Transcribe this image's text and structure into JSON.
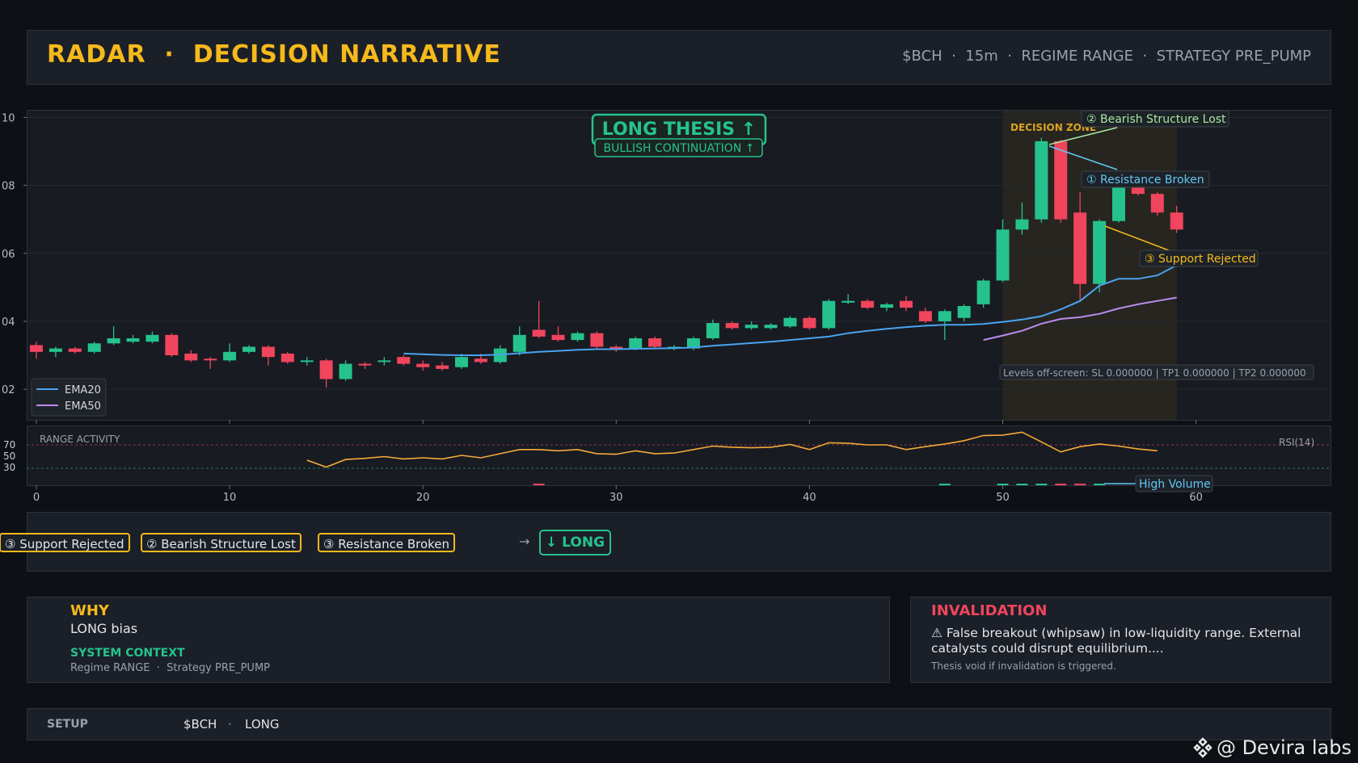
{
  "header": {
    "title": "RADAR  ·  DECISION NARRATIVE",
    "meta": "$BCH  ·  15m  ·  REGIME RANGE  ·  STRATEGY PRE_PUMP"
  },
  "thesis": {
    "title": "LONG THESIS  ↑",
    "subtitle": "BULLISH CONTINUATION ↑"
  },
  "decision_zone_label": "DECISION ZONE",
  "callouts": {
    "bearish": "② Bearish Structure Lost",
    "resistance": "① Resistance Broken",
    "support": "③ Support Rejected",
    "high_volume": "High Volume"
  },
  "levels_note": "Levels off-screen: SL 0.000000 | TP1 0.000000 | TP2 0.000000",
  "rsi_panel": {
    "label": "RANGE ACTIVITY",
    "indicator": "RSI(14)",
    "levels": [
      "70",
      "50",
      "30"
    ]
  },
  "chips": {
    "support": "③ Support Rejected",
    "bearish": "② Bearish Structure Lost",
    "resistance": "③ Resistance Broken",
    "arrow": "→",
    "long": "↓ LONG"
  },
  "why": {
    "heading": "WHY",
    "bias": "LONG bias",
    "context_heading": "SYSTEM CONTEXT",
    "context": "Regime RANGE  ·  Strategy PRE_PUMP"
  },
  "invalidation": {
    "heading": "INVALIDATION",
    "text": "⚠ False breakout (whipsaw) in low-liquidity range. External catalysts could disrupt equilibrium....",
    "note": "Thesis void if invalidation is triggered."
  },
  "setup": {
    "label": "SETUP",
    "symbol": "$BCH",
    "sep": "·",
    "direction": "LONG"
  },
  "watermark": "@ Devira labs",
  "colors": {
    "accent": "#f5b91c",
    "bull": "#26c28e",
    "bear": "#f0455d",
    "ema20": "#4aa3f0",
    "ema50": "#b98cf0",
    "rsi": "#f5a93a",
    "volume_label": "#63c6f5"
  },
  "chart_data": {
    "type": "candlestick",
    "x_ticks": [
      0,
      10,
      20,
      30,
      40,
      50,
      60
    ],
    "xlim": [
      -0.5,
      67
    ],
    "y_ticks": [
      {
        "v": 10,
        "label": "10"
      },
      {
        "v": 8,
        "label": "08"
      },
      {
        "v": 6,
        "label": "06"
      },
      {
        "v": 4,
        "label": "04"
      },
      {
        "v": 2,
        "label": "02"
      }
    ],
    "ylim": [
      1.1,
      10.2
    ],
    "candles": [
      [
        3.3,
        3.1,
        3.4,
        2.9
      ],
      [
        3.1,
        3.2,
        3.25,
        2.95
      ],
      [
        3.2,
        3.1,
        3.25,
        3.05
      ],
      [
        3.1,
        3.35,
        3.4,
        3.05
      ],
      [
        3.35,
        3.5,
        3.85,
        3.3
      ],
      [
        3.4,
        3.5,
        3.6,
        3.35
      ],
      [
        3.4,
        3.6,
        3.7,
        3.35
      ],
      [
        3.6,
        3.0,
        3.65,
        2.95
      ],
      [
        3.05,
        2.85,
        3.15,
        2.8
      ],
      [
        2.9,
        2.85,
        2.95,
        2.6
      ],
      [
        2.85,
        3.1,
        3.35,
        2.8
      ],
      [
        3.1,
        3.25,
        3.3,
        3.05
      ],
      [
        3.25,
        2.95,
        3.3,
        2.7
      ],
      [
        3.05,
        2.8,
        3.1,
        2.75
      ],
      [
        2.85,
        2.85,
        2.95,
        2.7
      ],
      [
        2.85,
        2.3,
        2.9,
        2.05
      ],
      [
        2.3,
        2.75,
        2.85,
        2.25
      ],
      [
        2.75,
        2.7,
        2.8,
        2.6
      ],
      [
        2.85,
        2.85,
        2.95,
        2.7
      ],
      [
        2.95,
        2.75,
        3.0,
        2.7
      ],
      [
        2.75,
        2.65,
        2.85,
        2.55
      ],
      [
        2.7,
        2.6,
        2.8,
        2.55
      ],
      [
        2.65,
        2.95,
        3.05,
        2.6
      ],
      [
        2.9,
        2.8,
        3.05,
        2.75
      ],
      [
        2.8,
        3.2,
        3.3,
        2.75
      ],
      [
        3.1,
        3.6,
        3.85,
        3.0
      ],
      [
        3.75,
        3.55,
        4.6,
        3.5
      ],
      [
        3.6,
        3.45,
        3.85,
        3.4
      ],
      [
        3.45,
        3.65,
        3.7,
        3.4
      ],
      [
        3.65,
        3.25,
        3.7,
        3.2
      ],
      [
        3.25,
        3.2,
        3.3,
        3.1
      ],
      [
        3.2,
        3.5,
        3.55,
        3.15
      ],
      [
        3.5,
        3.25,
        3.55,
        3.2
      ],
      [
        3.2,
        3.25,
        3.3,
        3.15
      ],
      [
        3.2,
        3.5,
        3.55,
        3.15
      ],
      [
        3.5,
        3.95,
        4.05,
        3.45
      ],
      [
        3.95,
        3.8,
        4.0,
        3.75
      ],
      [
        3.8,
        3.9,
        4.0,
        3.75
      ],
      [
        3.8,
        3.9,
        3.95,
        3.75
      ],
      [
        3.85,
        4.1,
        4.15,
        3.8
      ],
      [
        4.1,
        3.8,
        4.15,
        3.75
      ],
      [
        3.8,
        4.6,
        4.65,
        3.75
      ],
      [
        4.55,
        4.6,
        4.8,
        4.5
      ],
      [
        4.6,
        4.4,
        4.65,
        4.35
      ],
      [
        4.4,
        4.5,
        4.55,
        4.3
      ],
      [
        4.6,
        4.4,
        4.75,
        4.3
      ],
      [
        4.3,
        4.0,
        4.4,
        3.95
      ],
      [
        4.0,
        4.3,
        4.35,
        3.45
      ],
      [
        4.1,
        4.45,
        4.5,
        4.0
      ],
      [
        4.5,
        5.2,
        5.25,
        4.4
      ],
      [
        5.2,
        6.7,
        7.0,
        5.15
      ],
      [
        6.7,
        7.0,
        7.5,
        6.55
      ],
      [
        7.0,
        9.3,
        9.4,
        6.9
      ],
      [
        9.3,
        7.0,
        9.35,
        6.9
      ],
      [
        7.2,
        5.1,
        7.8,
        4.6
      ],
      [
        5.1,
        6.95,
        7.0,
        4.85
      ],
      [
        6.95,
        8.0,
        8.1,
        6.9
      ],
      [
        8.0,
        7.75,
        8.3,
        7.7
      ],
      [
        7.75,
        7.2,
        7.8,
        7.1
      ],
      [
        7.2,
        6.7,
        7.4,
        6.6
      ]
    ],
    "ema20": {
      "start": 19,
      "values": [
        3.05,
        3.03,
        3.01,
        3.0,
        3.0,
        3.02,
        3.06,
        3.1,
        3.13,
        3.16,
        3.18,
        3.18,
        3.19,
        3.2,
        3.21,
        3.23,
        3.28,
        3.32,
        3.36,
        3.4,
        3.45,
        3.5,
        3.55,
        3.65,
        3.72,
        3.78,
        3.83,
        3.87,
        3.9,
        3.9,
        3.92,
        3.98,
        4.05,
        4.15,
        4.35,
        4.6,
        5.05,
        5.25,
        5.25,
        5.35,
        5.65,
        5.9
      ]
    },
    "ema50": {
      "start": 49,
      "values": [
        3.45,
        3.58,
        3.72,
        3.93,
        4.07,
        4.12,
        4.22,
        4.38,
        4.5,
        4.6,
        4.7
      ]
    },
    "rsi": {
      "start": 14,
      "ylim": [
        0,
        100
      ],
      "values": [
        44,
        32,
        45,
        47,
        50,
        46,
        48,
        46,
        52,
        48,
        55,
        62,
        62,
        60,
        62,
        55,
        54,
        60,
        55,
        56,
        62,
        68,
        66,
        65,
        66,
        71,
        62,
        75,
        74,
        70,
        70,
        62,
        67,
        72,
        80,
        92,
        93,
        100,
        77,
        58,
        67,
        72,
        68,
        63,
        60
      ]
    }
  }
}
